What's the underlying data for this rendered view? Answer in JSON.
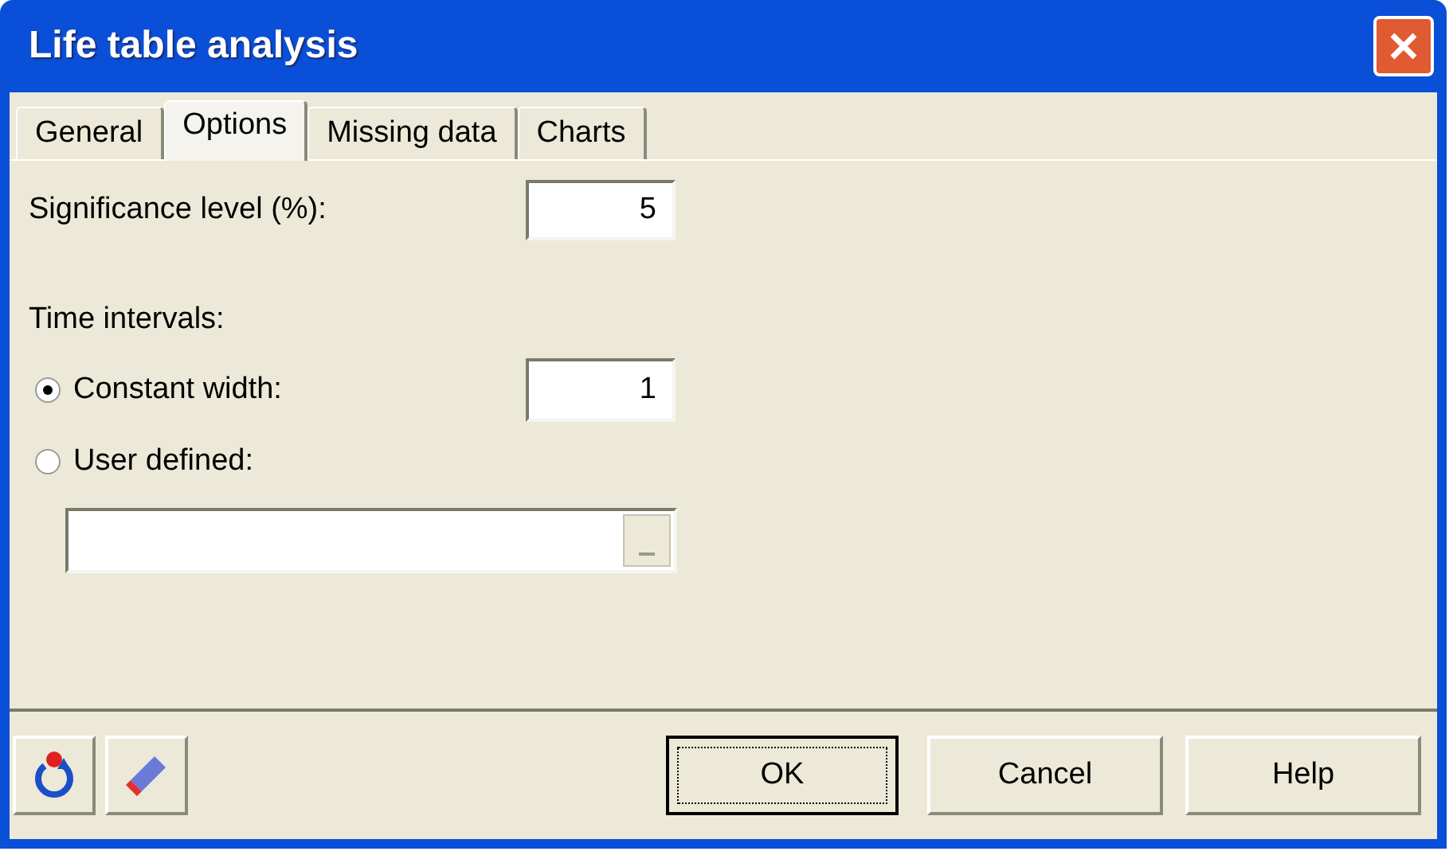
{
  "window": {
    "title": "Life table analysis"
  },
  "tabs": [
    {
      "label": "General",
      "selected": false
    },
    {
      "label": "Options",
      "selected": true
    },
    {
      "label": "Missing data",
      "selected": false
    },
    {
      "label": "Charts",
      "selected": false
    }
  ],
  "significance": {
    "label": "Significance level (%):",
    "value": "5"
  },
  "time_intervals": {
    "label": "Time intervals:"
  },
  "radios": [
    {
      "label": "Constant width:",
      "selected": true,
      "value": "1"
    },
    {
      "label": "User defined:",
      "selected": false
    }
  ],
  "buttons": [
    {
      "label": "OK",
      "default": true
    },
    {
      "label": "Cancel",
      "default": false
    },
    {
      "label": "Help",
      "default": false
    }
  ]
}
